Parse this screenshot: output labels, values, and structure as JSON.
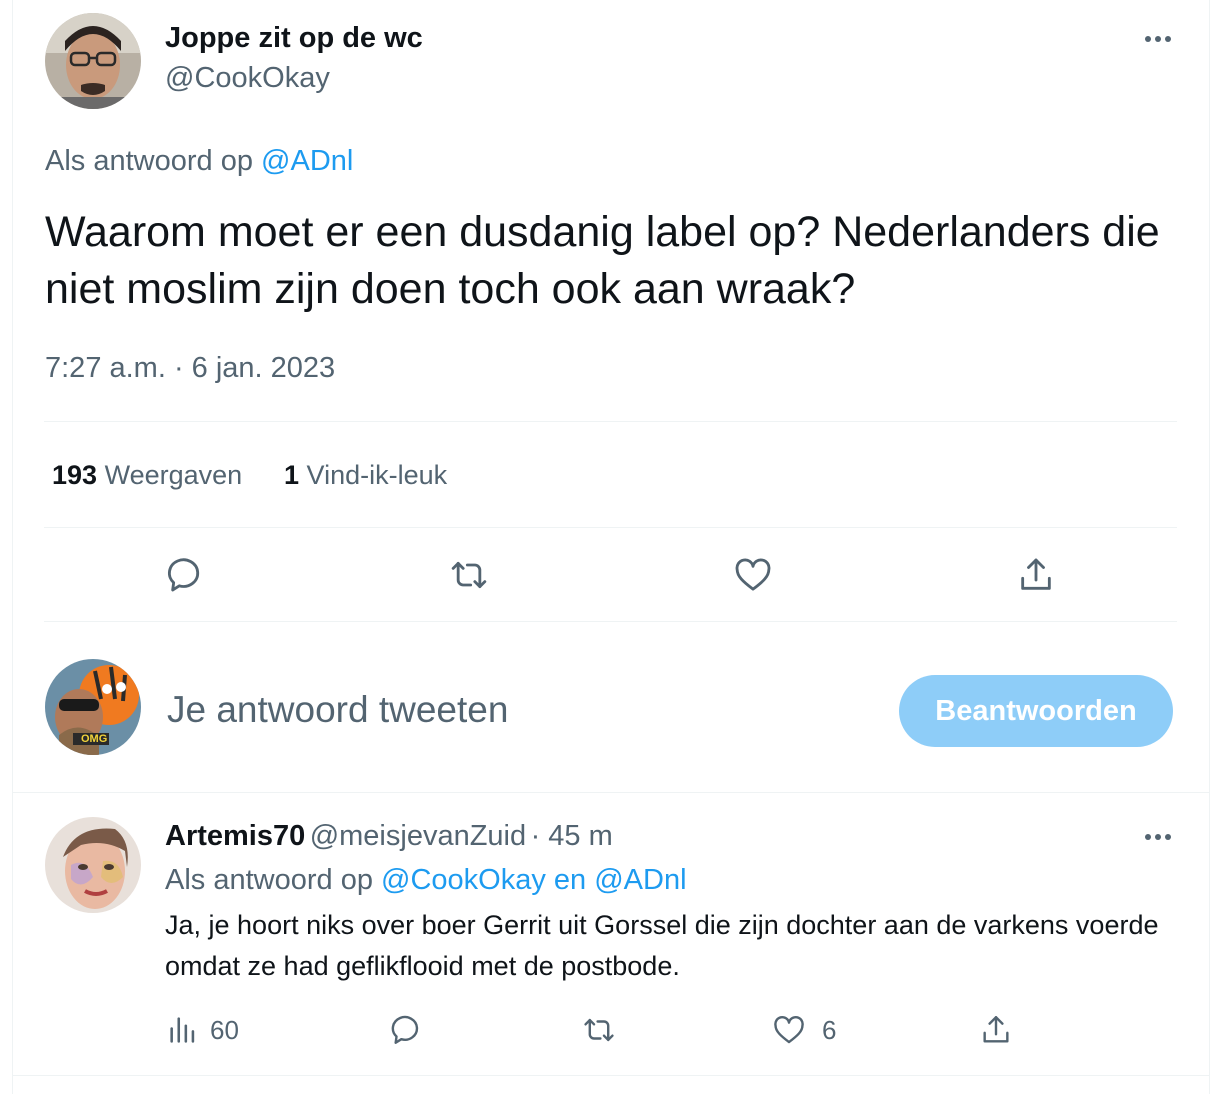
{
  "tweet": {
    "author_name": "Joppe zit op de wc",
    "author_handle": "@CookOkay",
    "reply_prefix": "Als antwoord op",
    "reply_target": "@ADnl",
    "text": "Waarom moet er een dusdanig label op? Nederlanders die niet moslim zijn doen toch ook aan wraak?",
    "timestamp": "7:27 a.m. · 6 jan. 2023",
    "views_count": "193",
    "views_label": "Weergaven",
    "likes_count": "1",
    "likes_label": "Vind-ik-leuk",
    "actions": [
      "reply-icon",
      "retweet-icon",
      "like-icon",
      "share-icon"
    ]
  },
  "composer": {
    "placeholder": "Je antwoord tweeten",
    "button_label": "Beantwoorden",
    "avatar_badge": "OMG"
  },
  "reply": {
    "author_name": "Artemis70",
    "author_handle": "@meisjevanZuid",
    "time": "· 45 m",
    "reply_prefix": "Als antwoord op",
    "reply_targets": "@CookOkay en @ADnl",
    "text": "Ja, je hoort niks over boer Gerrit uit Gorssel die zijn dochter aan de varkens voerde omdat ze had geflikflooid met de postbode.",
    "views_count": "60",
    "likes_count": "6"
  },
  "colors": {
    "link": "#1d9bf0",
    "muted": "#536471",
    "button_disabled": "#8ecdf8",
    "divider": "#eff3f4"
  }
}
